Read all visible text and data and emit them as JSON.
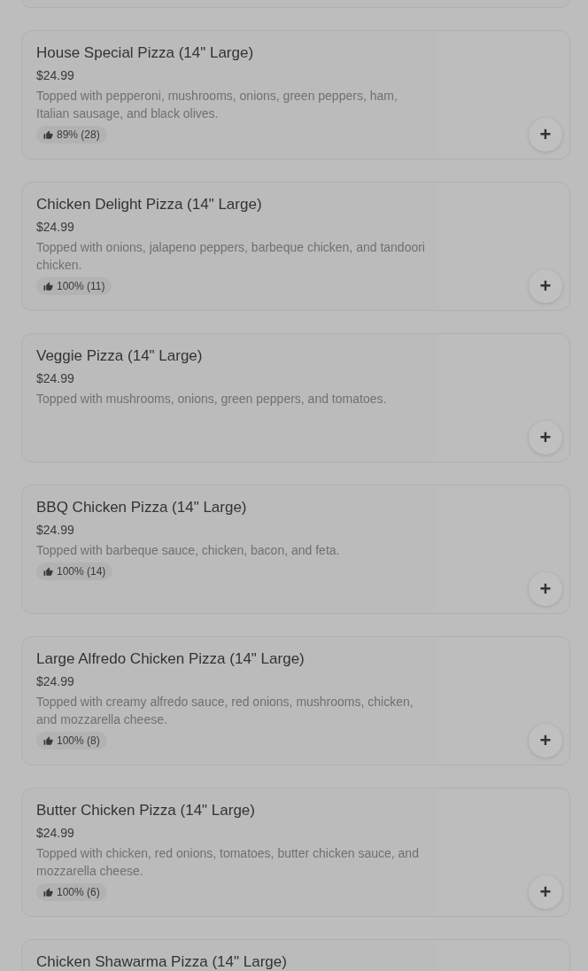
{
  "items": [
    {
      "name": "House Special Pizza (14\" Large)",
      "price": "$24.99",
      "description": "Topped with pepperoni, mushrooms, onions, green peppers, ham, Italian sausage, and black olives.",
      "rating": "89% (28)",
      "add": "+"
    },
    {
      "name": "Chicken Delight Pizza (14\" Large)",
      "price": "$24.99",
      "description": "Topped with onions, jalapeno peppers, barbeque chicken, and tandoori chicken.",
      "rating": "100% (11)",
      "add": "+"
    },
    {
      "name": "Veggie Pizza (14\" Large)",
      "price": "$24.99",
      "description": "Topped with mushrooms, onions, green peppers, and tomatoes.",
      "add": "+"
    },
    {
      "name": "BBQ Chicken Pizza (14\" Large)",
      "price": "$24.99",
      "description": "Topped with barbeque sauce, chicken, bacon, and feta.",
      "rating": "100% (14)",
      "add": "+"
    },
    {
      "name": "Large Alfredo Chicken Pizza (14\" Large)",
      "price": "$24.99",
      "description": "Topped with creamy alfredo sauce, red onions, mushrooms, chicken, and mozzarella cheese.",
      "rating": "100% (8)",
      "add": "+"
    },
    {
      "name": "Butter Chicken Pizza (14\" Large)",
      "price": "$24.99",
      "description": "Topped with chicken, red onions, tomatoes, butter chicken sauce, and mozzarella cheese.",
      "rating": "100% (6)",
      "add": "+"
    },
    {
      "name": "Chicken Shawarma Pizza (14\" Large)"
    }
  ]
}
